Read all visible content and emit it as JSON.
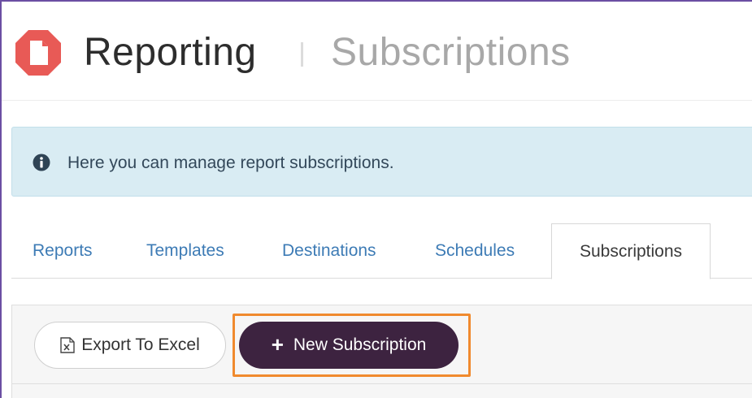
{
  "header": {
    "app_title": "Reporting",
    "section_title": "Subscriptions",
    "logo_icon": "document-hexagon-logo",
    "brand_color": "#e85a56"
  },
  "alert": {
    "icon": "info-circle-icon",
    "text": "Here you can manage report subscriptions."
  },
  "tabs": [
    {
      "label": "Reports",
      "active": false
    },
    {
      "label": "Templates",
      "active": false
    },
    {
      "label": "Destinations",
      "active": false
    },
    {
      "label": "Schedules",
      "active": false
    },
    {
      "label": "Subscriptions",
      "active": true
    }
  ],
  "toolbar": {
    "export_label": "Export To Excel",
    "export_icon": "excel-file-icon",
    "new_label": "New Subscription",
    "new_icon": "plus-icon",
    "new_button_color": "#3d2340",
    "highlight_color": "#f08a2e"
  }
}
